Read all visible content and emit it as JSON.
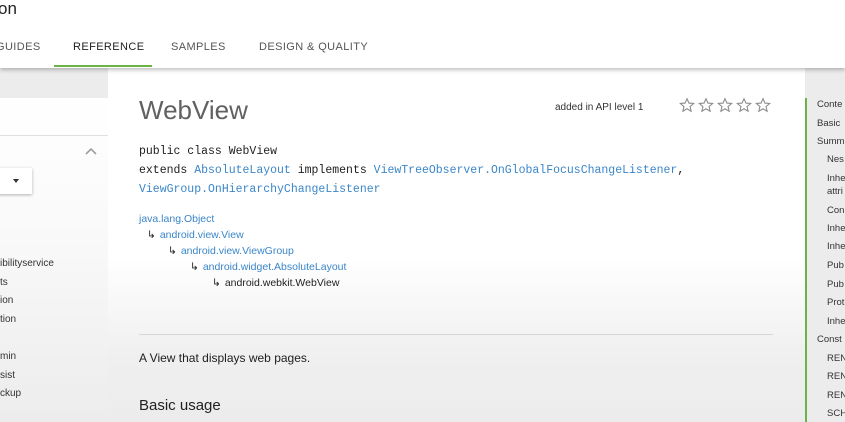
{
  "header": {
    "site_title": "on",
    "tabs": [
      {
        "label": "GUIDES"
      },
      {
        "label": "REFERENCE"
      },
      {
        "label": "SAMPLES"
      },
      {
        "label": "DESIGN & QUALITY"
      }
    ],
    "active_tab": "REFERENCE",
    "accent_color": "#6ab344"
  },
  "sidebar": {
    "items": [
      {
        "label": "ibilityservice"
      },
      {
        "label": "ts"
      },
      {
        "label": "ion"
      },
      {
        "label": "tion"
      },
      {
        "label": "min"
      },
      {
        "label": "sist"
      },
      {
        "label": "ckup"
      }
    ]
  },
  "main": {
    "title": "WebView",
    "api_level": "added in API level 1",
    "rating_stars": 5,
    "signature": {
      "line1": "public class WebView",
      "extends_kw": "extends ",
      "extends_class": "AbsoluteLayout",
      "implements_kw": " implements ",
      "iface1": "ViewTreeObserver.OnGlobalFocusChangeListener",
      "comma": ",",
      "iface2": "ViewGroup.OnHierarchyChangeListener"
    },
    "inheritance": [
      {
        "label": "java.lang.Object"
      },
      {
        "label": "android.view.View"
      },
      {
        "label": "android.view.ViewGroup"
      },
      {
        "label": "android.widget.AbsoluteLayout"
      },
      {
        "label": "android.webkit.WebView"
      }
    ],
    "arrow_glyph": "↳",
    "description": "A View that displays web pages.",
    "section_heading": "Basic usage"
  },
  "toc": {
    "items": [
      {
        "label": "Conte"
      },
      {
        "label": "Basic"
      },
      {
        "label": "Summ"
      },
      {
        "label": "Nes"
      },
      {
        "label": "Inhe"
      },
      {
        "label": "attri"
      },
      {
        "label": "Con"
      },
      {
        "label": "Inhe"
      },
      {
        "label": "Inhe"
      },
      {
        "label": "Pub"
      },
      {
        "label": "Pub"
      },
      {
        "label": "Prot"
      },
      {
        "label": "Inhe"
      },
      {
        "label": "Const"
      },
      {
        "label": "REN"
      },
      {
        "label": "REN"
      },
      {
        "label": "REN"
      },
      {
        "label": "SCH"
      }
    ]
  }
}
